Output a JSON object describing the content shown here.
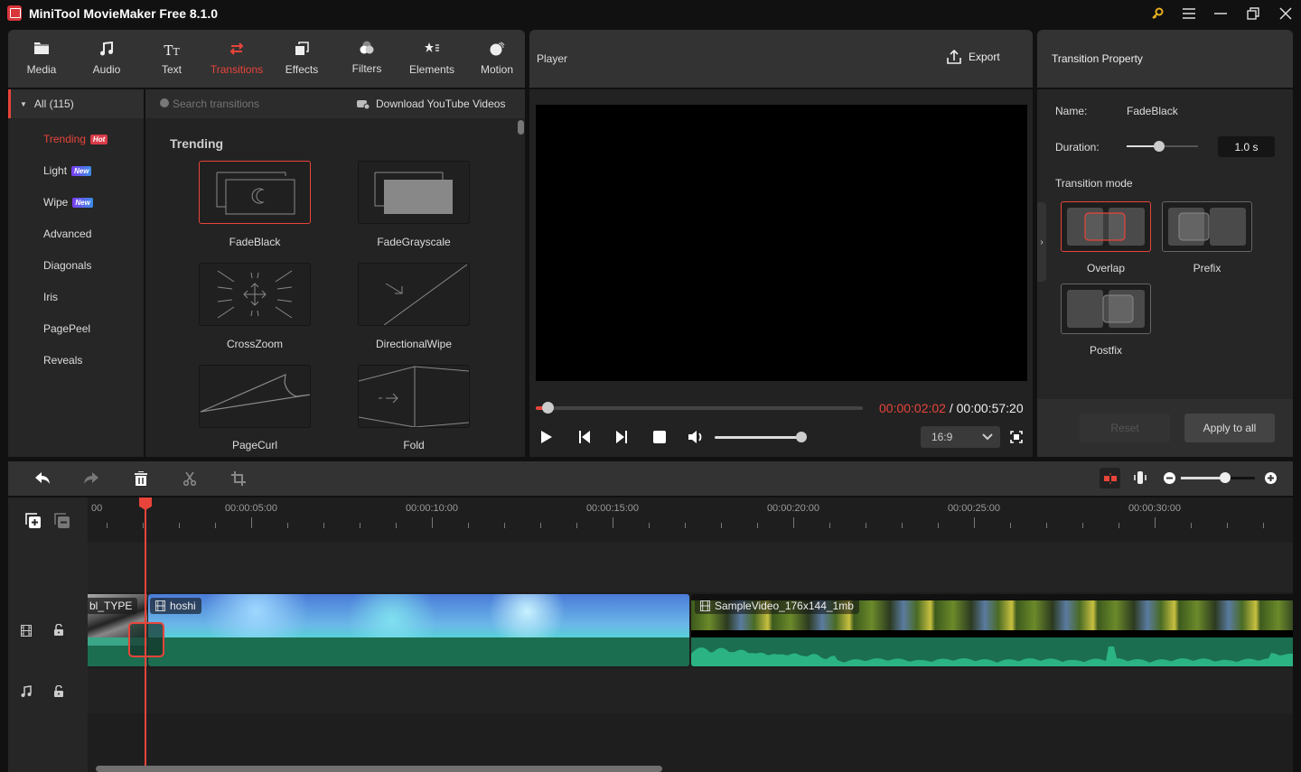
{
  "app": {
    "title": "MiniTool MovieMaker Free 8.1.0"
  },
  "window_controls": {
    "key": "upgrade-key",
    "menu": "menu",
    "minimize": "minimize",
    "maximize": "restore",
    "close": "close"
  },
  "toolbar": {
    "tabs": [
      {
        "label": "Media",
        "icon": "folder-icon"
      },
      {
        "label": "Audio",
        "icon": "music-icon"
      },
      {
        "label": "Text",
        "icon": "text-icon"
      },
      {
        "label": "Transitions",
        "icon": "transitions-icon",
        "active": true
      },
      {
        "label": "Effects",
        "icon": "effects-icon"
      },
      {
        "label": "Filters",
        "icon": "filters-icon"
      },
      {
        "label": "Elements",
        "icon": "elements-icon"
      },
      {
        "label": "Motion",
        "icon": "motion-icon"
      }
    ]
  },
  "categories": {
    "all_label": "All (115)",
    "items": [
      {
        "label": "Trending",
        "badge": "Hot",
        "active": true
      },
      {
        "label": "Light",
        "badge": "New"
      },
      {
        "label": "Wipe",
        "badge": "New"
      },
      {
        "label": "Advanced"
      },
      {
        "label": "Diagonals"
      },
      {
        "label": "Iris"
      },
      {
        "label": "PagePeel"
      },
      {
        "label": "Reveals"
      }
    ]
  },
  "library": {
    "search_placeholder": "Search transitions",
    "download_label": "Download YouTube Videos",
    "section_title": "Trending",
    "transitions": [
      {
        "name": "FadeBlack",
        "selected": true
      },
      {
        "name": "FadeGrayscale"
      },
      {
        "name": "CrossZoom"
      },
      {
        "name": "DirectionalWipe"
      },
      {
        "name": "PageCurl"
      },
      {
        "name": "Fold"
      }
    ]
  },
  "player": {
    "title": "Player",
    "export_label": "Export",
    "current_time": "00:00:02:02",
    "separator": " / ",
    "total_time": "00:00:57:20",
    "progress": 0.035,
    "volume": 1.0,
    "aspect_ratio": "16:9"
  },
  "property": {
    "title": "Transition Property",
    "name_label": "Name:",
    "name_value": "FadeBlack",
    "duration_label": "Duration:",
    "duration_value": "1.0 s",
    "duration_slider": 0.45,
    "mode_label": "Transition mode",
    "modes": [
      {
        "label": "Overlap",
        "selected": true
      },
      {
        "label": "Prefix"
      },
      {
        "label": "Postfix"
      }
    ],
    "reset_label": "Reset",
    "apply_all_label": "Apply to all"
  },
  "timeline": {
    "zoom_level": 0.6,
    "ruler_labels": [
      "00",
      "00:00:05:00",
      "00:00:10:00",
      "00:00:15:00",
      "00:00:20:00",
      "00:00:25:00",
      "00:00:30:00"
    ],
    "clips": [
      {
        "name": "bl_TYPE"
      },
      {
        "name": "hoshi"
      },
      {
        "name": "SampleVideo_176x144_1mb"
      }
    ]
  },
  "colors": {
    "accent": "#e8443a",
    "audio_wave": "#1f6e50",
    "audio_peak": "#2bb383",
    "panel": "#333333"
  }
}
